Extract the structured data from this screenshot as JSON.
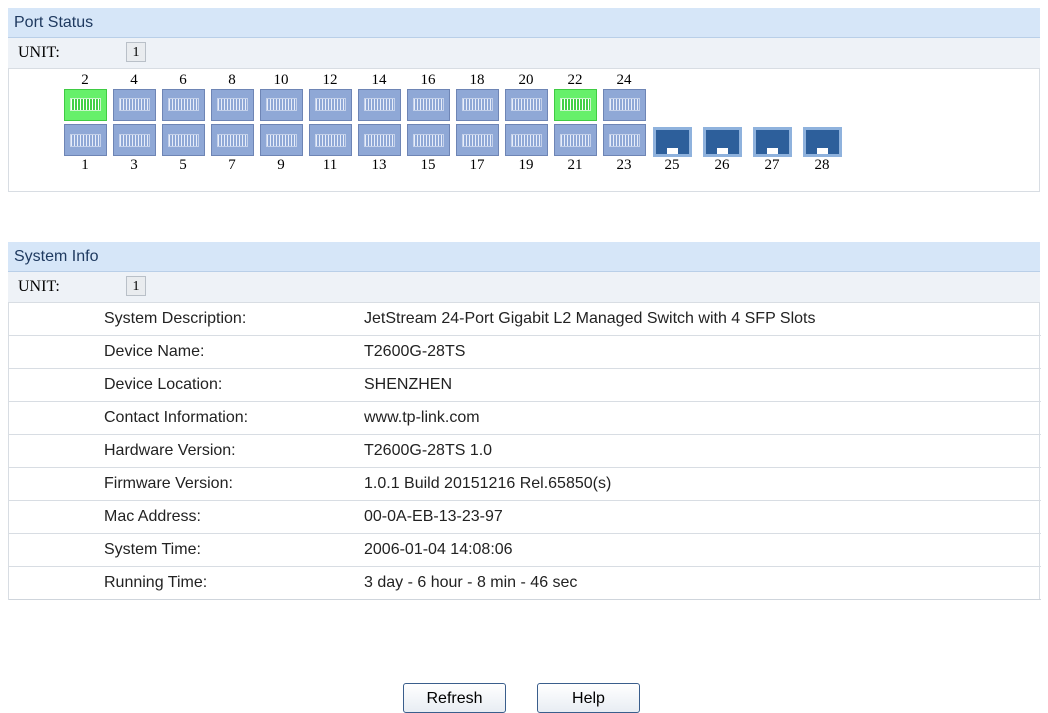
{
  "port_status": {
    "title": "Port Status",
    "unit_label": "UNIT:",
    "unit_value": "1",
    "top_numbers": [
      "2",
      "4",
      "6",
      "8",
      "10",
      "12",
      "14",
      "16",
      "18",
      "20",
      "22",
      "24"
    ],
    "bottom_numbers": [
      "1",
      "3",
      "5",
      "7",
      "9",
      "11",
      "13",
      "15",
      "17",
      "19",
      "21",
      "23"
    ],
    "sfp_numbers": [
      "25",
      "26",
      "27",
      "28"
    ],
    "active_ports": [
      "2",
      "22"
    ],
    "colors": {
      "link_up": "#66f06a",
      "link_down": "#8fa8d6",
      "sfp": "#2d5f9b"
    }
  },
  "system_info": {
    "title": "System Info",
    "unit_label": "UNIT:",
    "unit_value": "1",
    "rows": [
      {
        "key": "System Description:",
        "value": "JetStream 24-Port Gigabit L2 Managed Switch with 4 SFP Slots"
      },
      {
        "key": "Device Name:",
        "value": "T2600G-28TS"
      },
      {
        "key": "Device Location:",
        "value": "SHENZHEN"
      },
      {
        "key": "Contact Information:",
        "value": "www.tp-link.com"
      },
      {
        "key": "Hardware Version:",
        "value": "T2600G-28TS 1.0"
      },
      {
        "key": "Firmware Version:",
        "value": "1.0.1 Build 20151216 Rel.65850(s)"
      },
      {
        "key": "Mac Address:",
        "value": "00-0A-EB-13-23-97"
      },
      {
        "key": "System Time:",
        "value": "2006-01-04 14:08:06"
      },
      {
        "key": "Running Time:",
        "value": "3 day - 6 hour - 8 min - 46 sec"
      }
    ]
  },
  "buttons": {
    "refresh": "Refresh",
    "help": "Help"
  }
}
